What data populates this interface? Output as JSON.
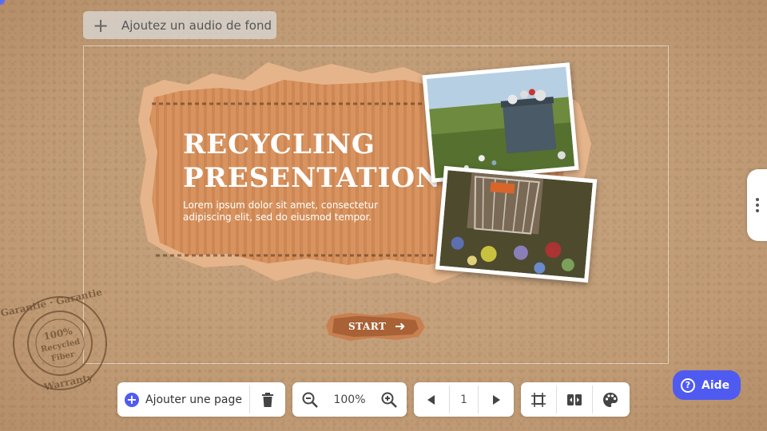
{
  "audio": {
    "label": "Ajoutez un audio de fond"
  },
  "slide": {
    "title": "RECYCLING\nPRESENTATION",
    "subtitle": "Lorem ipsum dolor sit amet, consectetur adipiscing elit, sed do eiusmod tempor.",
    "start_label": "START"
  },
  "stamp": {
    "text": "Garantie · Garantie · Warranty · 100% Recycled Fiber"
  },
  "toolbar": {
    "add_page_label": "Ajouter une page",
    "zoom_value": "100%",
    "page_number": "1"
  },
  "help": {
    "label": "Aide"
  },
  "colors": {
    "accent": "#4f5bf0",
    "cardboard": "#d7925f",
    "background": "#c4a27d"
  }
}
